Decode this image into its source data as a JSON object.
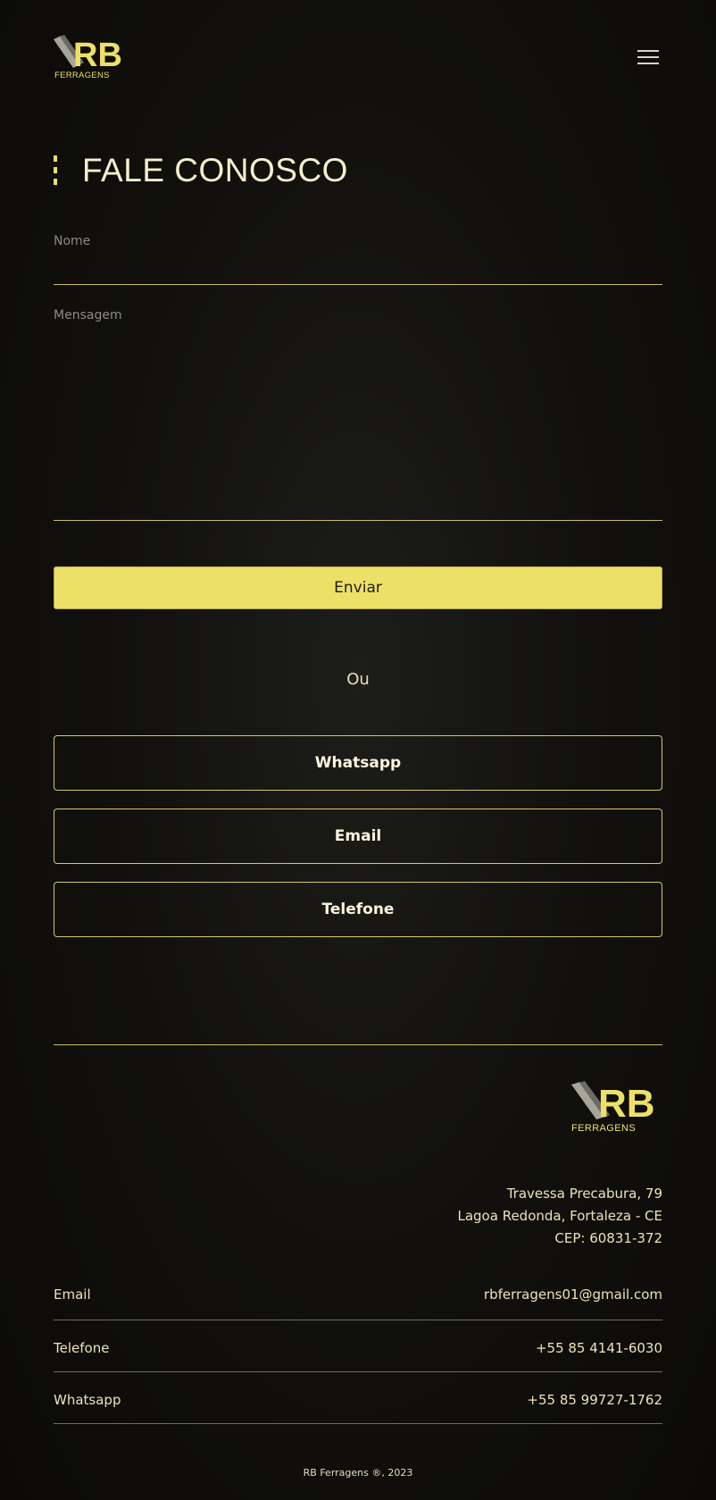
{
  "header": {
    "logo_text": "FERRAGENS",
    "logo_mark": "RB",
    "menu_icon": "hamburger-menu-icon"
  },
  "page": {
    "title": "FALE CONOSCO"
  },
  "form": {
    "name_label": "Nome",
    "message_label": "Mensagem",
    "submit_label": "Enviar"
  },
  "alternatives": {
    "or_label": "Ou",
    "buttons": [
      "Whatsapp",
      "Email",
      "Telefone"
    ]
  },
  "footer": {
    "logo_text": "FERRAGENS",
    "logo_mark": "RB",
    "address": [
      "Travessa Precabura, 79",
      "Lagoa Redonda, Fortaleza - CE",
      "CEP: 60831-372"
    ],
    "contacts": [
      {
        "label": "Email",
        "value": "rbferragens01@gmail.com"
      },
      {
        "label": "Telefone",
        "value": "+55 85 4141-6030"
      },
      {
        "label": "Whatsapp",
        "value": "+55 85 99727-1762"
      }
    ],
    "copyright": "RB Ferragens ®, 2023"
  },
  "colors": {
    "accent": "#ede067",
    "background": "#0f0e0b",
    "text": "#f2ecc7"
  }
}
